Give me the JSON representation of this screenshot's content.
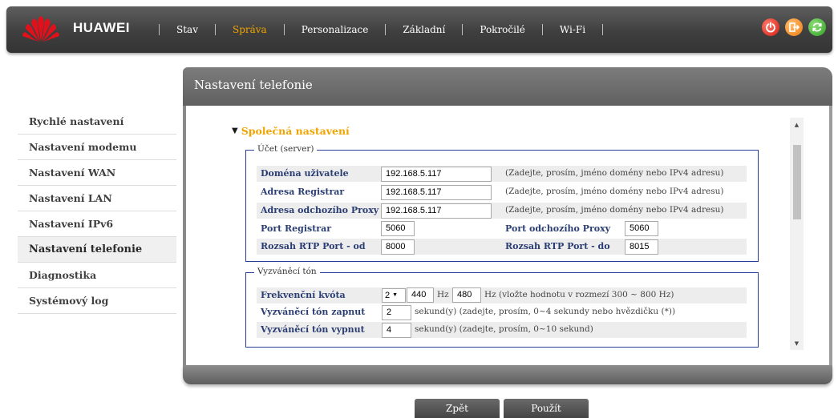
{
  "brand": "HUAWEI",
  "nav": {
    "items": [
      {
        "label": "Stav",
        "active": false
      },
      {
        "label": "Správa",
        "active": true
      },
      {
        "label": "Personalizace",
        "active": false
      },
      {
        "label": "Základní",
        "active": false
      },
      {
        "label": "Pokročilé",
        "active": false
      },
      {
        "label": "Wi-Fi",
        "active": false
      }
    ],
    "icons": [
      "power-icon",
      "logout-icon",
      "refresh-icon"
    ]
  },
  "sidebar": {
    "items": [
      {
        "label": "Rychlé nastavení",
        "active": false
      },
      {
        "label": "Nastavení modemu",
        "active": false
      },
      {
        "label": "Nastavení WAN",
        "active": false
      },
      {
        "label": "Nastavení LAN",
        "active": false
      },
      {
        "label": "Nastavení IPv6",
        "active": false
      },
      {
        "label": "Nastavení telefonie",
        "active": true
      },
      {
        "label": "Diagnostika",
        "active": false
      },
      {
        "label": "Systémový log",
        "active": false
      }
    ]
  },
  "panel": {
    "title": "Nastavení telefonie",
    "section_title": "Společná nastavení",
    "account": {
      "legend": "Účet (server)",
      "domain_label": "Doména uživatele",
      "domain_value": "192.168.5.117",
      "domain_hint": "(Zadejte, prosím, jméno domény nebo IPv4 adresu)",
      "registrar_label": "Adresa Registrar",
      "registrar_value": "192.168.5.117",
      "registrar_hint": "(Zadejte, prosím, jméno domény nebo IPv4 adresu)",
      "proxy_label": "Adresa odchozího Proxy",
      "proxy_value": "192.168.5.117",
      "proxy_hint": "(Zadejte, prosím, jméno domény nebo IPv4 adresu)",
      "port_registrar_label": "Port Registrar",
      "port_registrar_value": "5060",
      "port_proxy_label": "Port odchozího Proxy",
      "port_proxy_value": "5060",
      "rtp_from_label": "Rozsah RTP Port - od",
      "rtp_from_value": "8000",
      "rtp_to_label": "Rozsah RTP Port - do",
      "rtp_to_value": "8015"
    },
    "ringtone": {
      "legend": "Vyzváněcí tón",
      "freq_label": "Frekvenční kvóta",
      "freq_select": "2",
      "freq_hz1_value": "440",
      "freq_hz_unit": "Hz",
      "freq_hz2_value": "480",
      "freq_hint": "Hz (vložte hodnotu v rozmezí 300 ~ 800 Hz)",
      "on_label": "Vyzváněcí tón zapnut",
      "on_value": "2",
      "on_hint": "sekund(y) (zadejte, prosím, 0~4 sekundy nebo hvězdičku (*))",
      "off_label": "Vyzváněcí tón vypnut",
      "off_value": "4",
      "off_hint": "sekund(y) (zadejte, prosím, 0~10 sekund)"
    }
  },
  "buttons": {
    "back": "Zpět",
    "apply": "Použít"
  },
  "colors": {
    "accent": "#f0a400",
    "label": "#2b3e73",
    "group_border": "#2b3e97",
    "bar": "#3f3f3f"
  }
}
